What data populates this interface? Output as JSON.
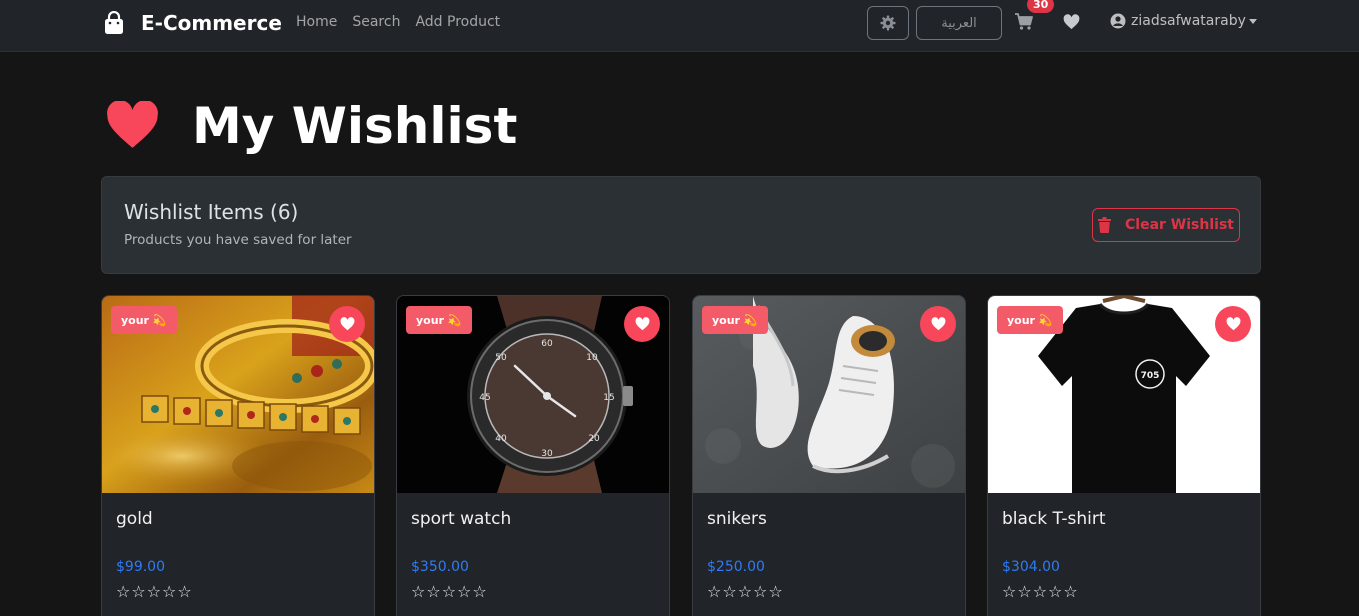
{
  "nav": {
    "brand": "E-Commerce",
    "links": [
      "Home",
      "Search",
      "Add Product"
    ],
    "language_label": "العربية",
    "cart_count": "30",
    "username": "ziadsafwataraby"
  },
  "page": {
    "title": "My Wishlist"
  },
  "panel": {
    "title": "Wishlist Items (6)",
    "subtitle": "Products you have saved for later",
    "clear_label": "Clear Wishlist"
  },
  "colors": {
    "accent_red": "#f8465a",
    "link_blue": "#2f7bf5",
    "danger": "#dc3545"
  },
  "products": [
    {
      "tag": "your 💫",
      "name": "gold",
      "price": "$99.00",
      "rating": 0
    },
    {
      "tag": "your 💫",
      "name": "sport watch",
      "price": "$350.00",
      "rating": 0
    },
    {
      "tag": "your 💫",
      "name": "snikers",
      "price": "$250.00",
      "rating": 0
    },
    {
      "tag": "your 💫",
      "name": "black T-shirt",
      "price": "$304.00",
      "rating": 0
    }
  ]
}
